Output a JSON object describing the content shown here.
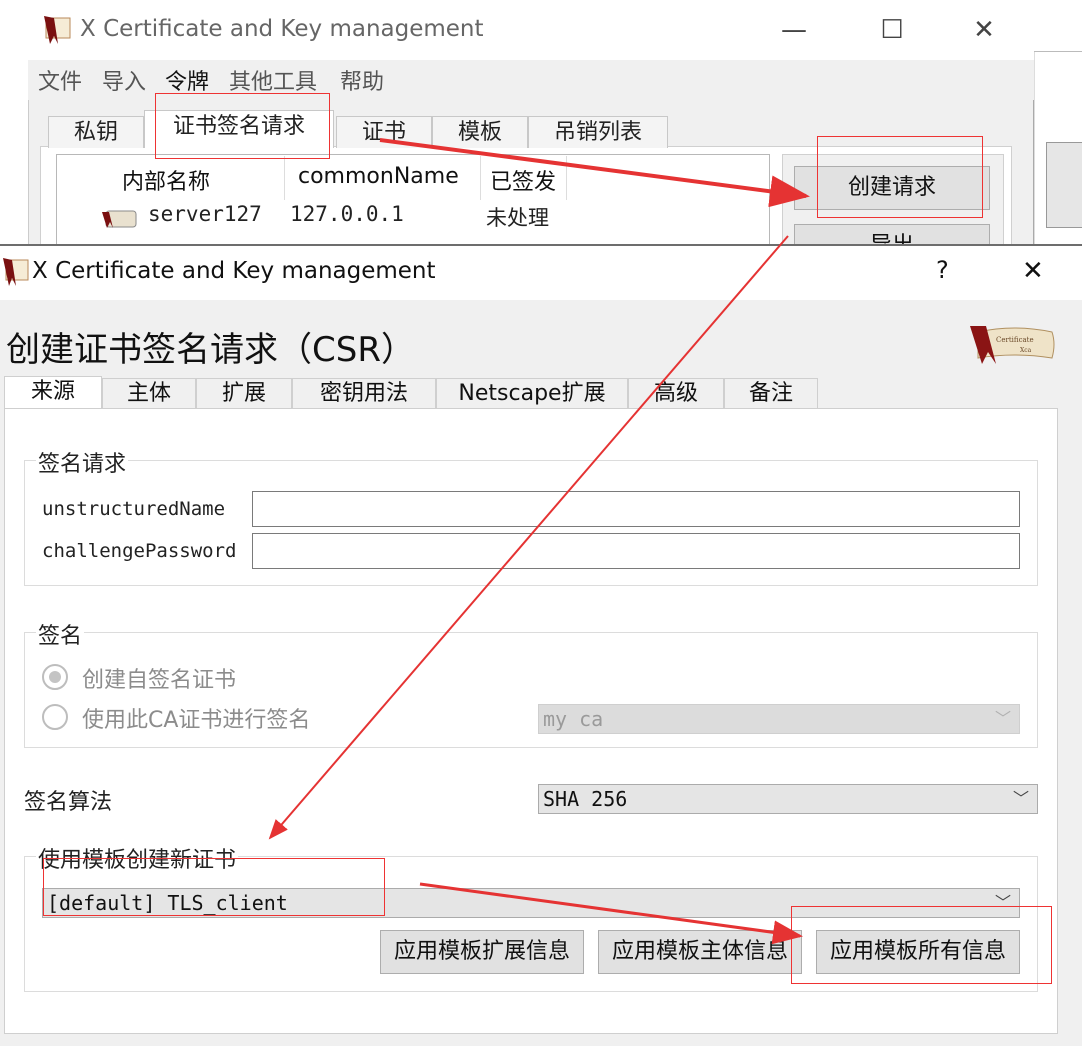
{
  "bg_window": {
    "title": "X Certificate and Key management",
    "controls": {
      "minimize": "—",
      "maximize": "☐",
      "close": "✕"
    },
    "menu": [
      "文件",
      "导入",
      "令牌",
      "其他工具",
      "帮助"
    ],
    "tabs": [
      "私钥",
      "证书签名请求",
      "证书",
      "模板",
      "吊销列表"
    ],
    "active_tab": "证书签名请求",
    "list": {
      "headers": [
        "内部名称",
        "commonName",
        "已签发"
      ],
      "row": {
        "name": "server127",
        "common_name": "127.0.0.1",
        "status": "未处理"
      }
    },
    "buttons": {
      "create_request": "创建请求",
      "export": "导出"
    }
  },
  "dialog": {
    "title": "X Certificate and Key management",
    "help": "?",
    "close": "✕",
    "heading": "创建证书签名请求（CSR）",
    "tabs": [
      "来源",
      "主体",
      "扩展",
      "密钥用法",
      "Netscape扩展",
      "高级",
      "备注"
    ],
    "active_tab": "来源",
    "signing_request": {
      "title": "签名请求",
      "unstructured_label": "unstructuredName",
      "unstructured_value": "",
      "challenge_label": "challengePassword",
      "challenge_value": ""
    },
    "signing": {
      "title": "签名",
      "self_signed": "创建自签名证书",
      "use_ca": "使用此CA证书进行签名",
      "ca_select": "my ca"
    },
    "algorithm": {
      "label": "签名算法",
      "value": "SHA 256"
    },
    "template": {
      "title": "使用模板创建新证书",
      "value": "[default] TLS_client",
      "apply_ext": "应用模板扩展信息",
      "apply_subject": "应用模板主体信息",
      "apply_all": "应用模板所有信息"
    }
  },
  "colors": {
    "annotation": "#e53333",
    "window_bg": "#f0f0f0"
  },
  "icons": [
    "certificate-logo-icon",
    "chevron-down-icon",
    "close-icon"
  ]
}
